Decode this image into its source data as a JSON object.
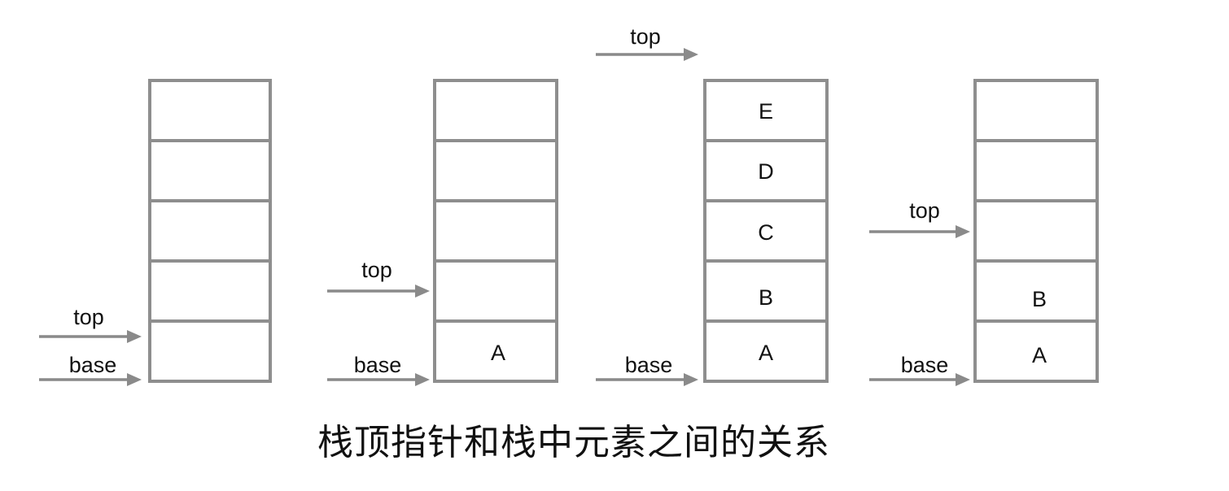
{
  "caption": "栈顶指针和栈中元素之间的关系",
  "stacks": [
    {
      "cells": [
        "",
        "",
        "",
        "",
        ""
      ],
      "pointers": [
        {
          "label": "top",
          "slot": "top-of-cell-0"
        },
        {
          "label": "base",
          "slot": "bottom"
        }
      ]
    },
    {
      "cells": [
        "A",
        "",
        "",
        "",
        ""
      ],
      "pointers": [
        {
          "label": "top",
          "slot": "top-of-cell-1"
        },
        {
          "label": "base",
          "slot": "bottom"
        }
      ]
    },
    {
      "cells": [
        "A",
        "B",
        "C",
        "D",
        "E"
      ],
      "pointers": [
        {
          "label": "top",
          "slot": "above-stack"
        },
        {
          "label": "base",
          "slot": "bottom"
        }
      ]
    },
    {
      "cells": [
        "A",
        "B",
        "",
        "",
        ""
      ],
      "pointers": [
        {
          "label": "top",
          "slot": "top-of-cell-2"
        },
        {
          "label": "base",
          "slot": "bottom"
        }
      ]
    }
  ]
}
